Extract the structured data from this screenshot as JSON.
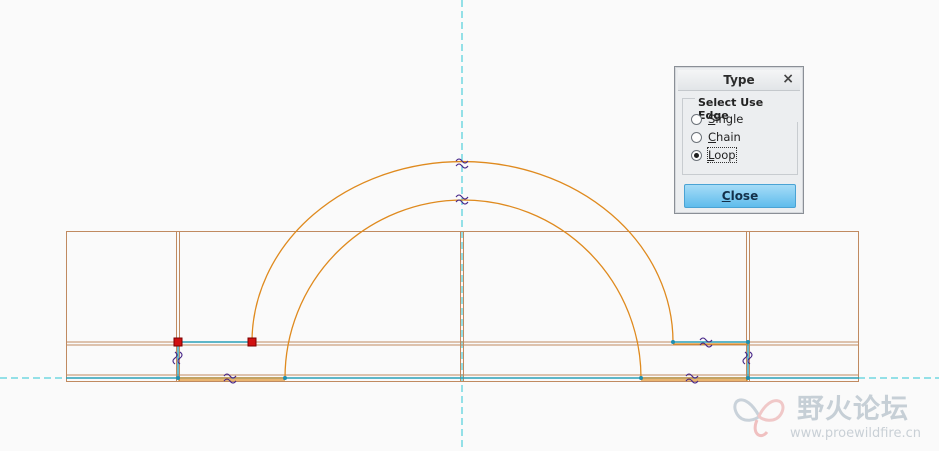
{
  "dialog": {
    "title": "Type",
    "close_glyph": "×",
    "group_label": "Select Use Edge",
    "options": [
      {
        "mnemonic": "S",
        "rest": "ingle",
        "label": "Single",
        "selected": false
      },
      {
        "mnemonic": "C",
        "rest": "hain",
        "label": "Chain",
        "selected": false
      },
      {
        "mnemonic": "L",
        "rest": "oop",
        "label": "Loop",
        "selected": true
      }
    ],
    "close_button": {
      "mnemonic": "C",
      "rest": "lose",
      "label": "Close"
    }
  },
  "watermark": {
    "title": "野火论坛",
    "url": "www.proewildfire.cn"
  },
  "colors": {
    "background": "#fafafa",
    "centerline": "#2cc7d4",
    "sketch_edge": "#d98a2b",
    "reference_edge": "#b58a6a",
    "used_edge": "#2aa0b8",
    "selected_vertex": "#d01010",
    "constraint": "#5a2a8a"
  },
  "icons": [
    "close-icon",
    "radio-icon",
    "watermark-logo-icon"
  ]
}
